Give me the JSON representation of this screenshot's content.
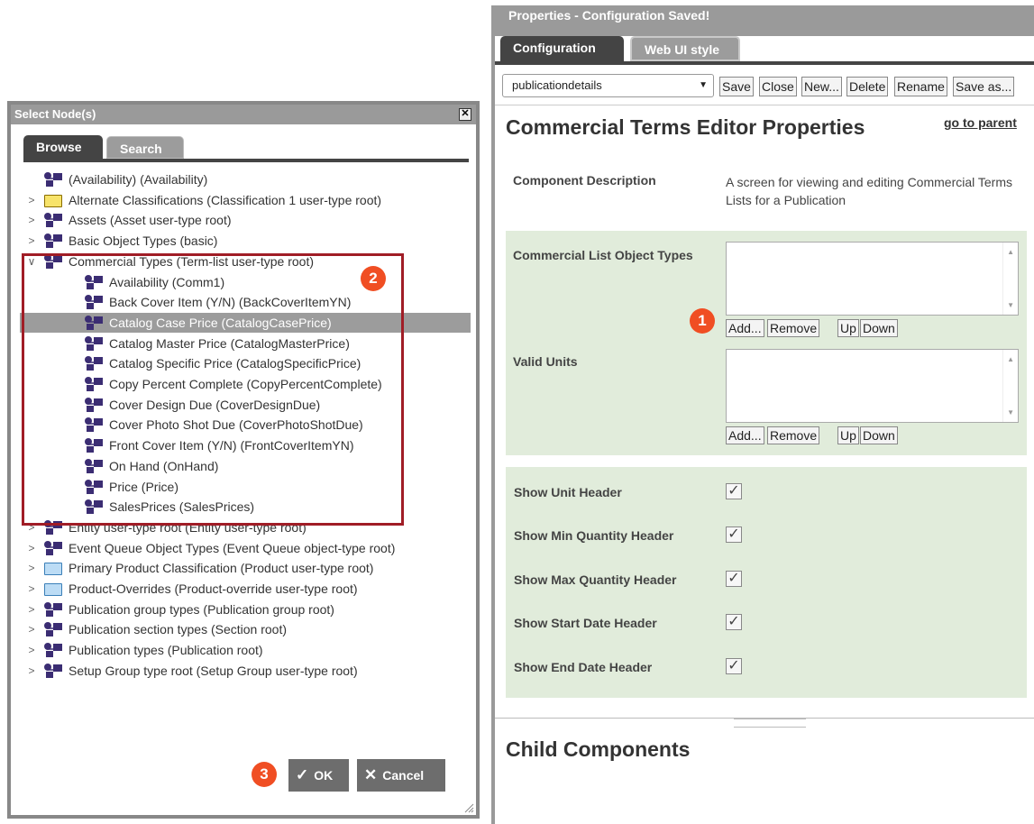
{
  "select_dialog": {
    "title": "Select Node(s)",
    "close_glyph": "✕",
    "tabs": [
      "Browse",
      "Search"
    ],
    "tree": [
      {
        "label": "(Availability) (Availability)",
        "level": 0,
        "expander": "",
        "icon": "node-type-icon"
      },
      {
        "label": "Alternate Classifications (Classification 1 user-type root)",
        "level": 0,
        "expander": ">",
        "icon": "folder-yellow-icon"
      },
      {
        "label": "Assets (Asset user-type root)",
        "level": 0,
        "expander": ">",
        "icon": "node-type-icon"
      },
      {
        "label": "Basic Object Types (basic)",
        "level": 0,
        "expander": ">",
        "icon": "node-type-icon"
      },
      {
        "label": "Commercial Types (Term-list user-type root)",
        "level": 0,
        "expander": "∨",
        "icon": "node-type-icon"
      },
      {
        "label": "Availability (Comm1)",
        "level": 1,
        "expander": "",
        "icon": "node-type-icon"
      },
      {
        "label": "Back Cover Item (Y/N) (BackCoverItemYN)",
        "level": 1,
        "expander": "",
        "icon": "node-type-icon"
      },
      {
        "label": "Catalog Case Price (CatalogCasePrice)",
        "level": 1,
        "expander": "",
        "icon": "node-type-icon",
        "selected": true
      },
      {
        "label": "Catalog Master Price (CatalogMasterPrice)",
        "level": 1,
        "expander": "",
        "icon": "node-type-icon"
      },
      {
        "label": "Catalog Specific Price (CatalogSpecificPrice)",
        "level": 1,
        "expander": "",
        "icon": "node-type-icon"
      },
      {
        "label": "Copy Percent Complete (CopyPercentComplete)",
        "level": 1,
        "expander": "",
        "icon": "node-type-icon"
      },
      {
        "label": "Cover Design Due (CoverDesignDue)",
        "level": 1,
        "expander": "",
        "icon": "node-type-icon"
      },
      {
        "label": "Cover Photo Shot Due (CoverPhotoShotDue)",
        "level": 1,
        "expander": "",
        "icon": "node-type-icon"
      },
      {
        "label": "Front Cover Item (Y/N) (FrontCoverItemYN)",
        "level": 1,
        "expander": "",
        "icon": "node-type-icon"
      },
      {
        "label": "On Hand (OnHand)",
        "level": 1,
        "expander": "",
        "icon": "node-type-icon"
      },
      {
        "label": "Price (Price)",
        "level": 1,
        "expander": "",
        "icon": "node-type-icon"
      },
      {
        "label": "SalesPrices (SalesPrices)",
        "level": 1,
        "expander": "",
        "icon": "node-type-icon"
      },
      {
        "label": "Entity user-type root (Entity user-type root)",
        "level": 0,
        "expander": ">",
        "icon": "node-type-icon"
      },
      {
        "label": "Event Queue Object Types (Event Queue object-type root)",
        "level": 0,
        "expander": ">",
        "icon": "node-type-icon"
      },
      {
        "label": "Primary Product Classification (Product user-type root)",
        "level": 0,
        "expander": ">",
        "icon": "folder-blue-icon"
      },
      {
        "label": "Product-Overrides (Product-override user-type root)",
        "level": 0,
        "expander": ">",
        "icon": "folder-blue-icon"
      },
      {
        "label": "Publication group types (Publication group root)",
        "level": 0,
        "expander": ">",
        "icon": "node-type-icon"
      },
      {
        "label": "Publication section types (Section root)",
        "level": 0,
        "expander": ">",
        "icon": "node-type-icon"
      },
      {
        "label": "Publication types (Publication root)",
        "level": 0,
        "expander": ">",
        "icon": "node-type-icon"
      },
      {
        "label": "Setup Group type root (Setup Group user-type root)",
        "level": 0,
        "expander": ">",
        "icon": "node-type-icon"
      }
    ],
    "ok_label": "OK",
    "ok_glyph": "✓",
    "cancel_label": "Cancel",
    "cancel_glyph": "✕"
  },
  "callouts": {
    "one": "1",
    "two": "2",
    "three": "3",
    "color": "#f04e23",
    "highlight_box_color": "#a01d26"
  },
  "properties": {
    "title": "Properties - Configuration Saved!",
    "tabs": [
      "Configuration",
      "Web UI style"
    ],
    "config_select": "publicationdetails",
    "toolbar_buttons": [
      "Save",
      "Close",
      "New...",
      "Delete",
      "Rename",
      "Save as..."
    ],
    "heading": "Commercial Terms Editor Properties",
    "go_to_parent": "go to parent",
    "component_description_label": "Component Description",
    "component_description_value": "A screen for viewing and editing Commercial Terms Lists for a Publication",
    "commercial_list_label": "Commercial List Object Types",
    "valid_units_label": "Valid Units",
    "list_buttons": [
      "Add...",
      "Remove",
      "Up",
      "Down"
    ],
    "checkboxes": [
      {
        "label": "Show Unit Header",
        "checked": true
      },
      {
        "label": "Show Min Quantity Header",
        "checked": true
      },
      {
        "label": "Show Max Quantity Header",
        "checked": true
      },
      {
        "label": "Show Start Date Header",
        "checked": true
      },
      {
        "label": "Show End Date Header",
        "checked": true
      }
    ],
    "check_glyph": "✓",
    "child_components_heading": "Child Components",
    "panel_green": "#e1ecdb"
  }
}
